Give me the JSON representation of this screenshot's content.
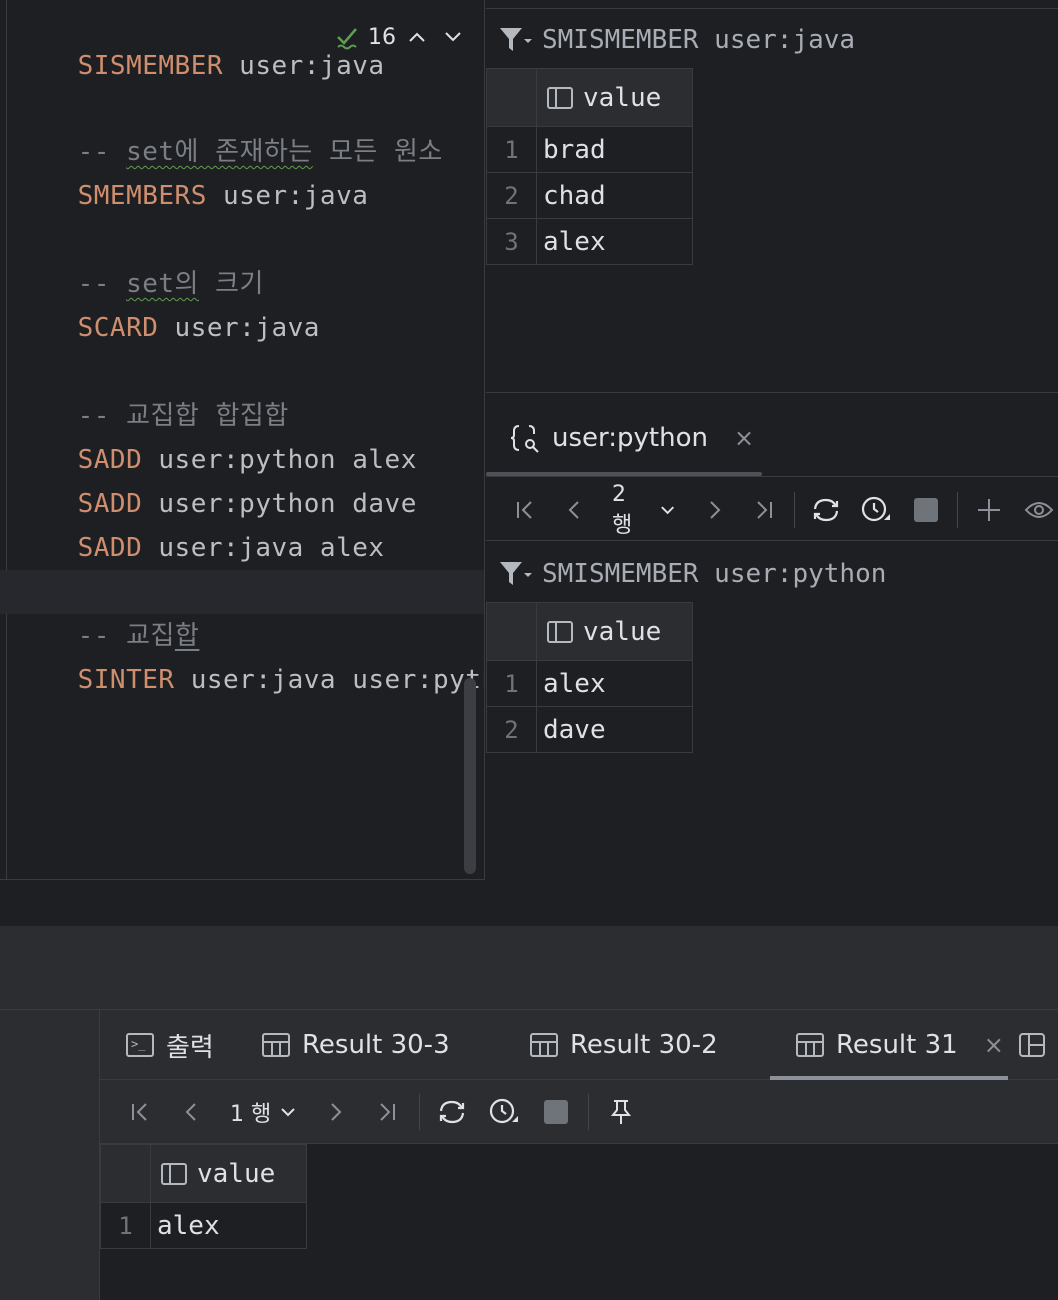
{
  "editor": {
    "lines": [
      {
        "kw": "SISMEMBER",
        "rest": " user:java"
      },
      {
        "comment_prefix": "-- ",
        "comment_squig": "set에 존재하는",
        "comment_rest": " 모든 원소"
      },
      {
        "kw": "SMEMBERS",
        "rest": " user:java"
      },
      {
        "comment_prefix": "-- ",
        "comment_squig": "set의",
        "comment_rest": " 크기"
      },
      {
        "kw": "SCARD",
        "rest": " user:java"
      },
      {
        "comment": "-- 교집합 합집합"
      },
      {
        "kw": "SADD",
        "rest": " user:python alex"
      },
      {
        "kw": "SADD",
        "rest": " user:python dave"
      },
      {
        "kw": "SADD",
        "rest": " user:java alex"
      },
      {
        "comment_prefix": "-- 교집",
        "comment_under": "합"
      },
      {
        "kw": "SINTER",
        "rest": " user:java user:python"
      }
    ],
    "inspection": {
      "icon": "check-double-icon",
      "count": "16",
      "up": "^",
      "down": "v"
    }
  },
  "result_top": {
    "query": "SMISMEMBER user:java",
    "column": "value",
    "rows": [
      {
        "n": "1",
        "v": "brad"
      },
      {
        "n": "2",
        "v": "chad"
      },
      {
        "n": "3",
        "v": "alex"
      }
    ]
  },
  "result_python": {
    "tab_label": "user:python",
    "tab_close": "×",
    "rows_selector": "2 행",
    "query": "SMISMEMBER user:python",
    "column": "value",
    "rows": [
      {
        "n": "1",
        "v": "alex"
      },
      {
        "n": "2",
        "v": "dave"
      }
    ]
  },
  "bottom": {
    "tabs": {
      "output": "출력",
      "r303": "Result 30-3",
      "r302": "Result 30-2",
      "r31": "Result 31",
      "close": "×"
    },
    "rows_selector": "1 행",
    "column": "value",
    "rows": [
      {
        "n": "1",
        "v": "alex"
      }
    ]
  },
  "colors": {
    "keyword": "#cf8e6d",
    "comment": "#7a7e85",
    "text": "#bcbec4",
    "background": "#1e1f22",
    "panel": "#2b2d30",
    "check": "#5f9e52"
  }
}
